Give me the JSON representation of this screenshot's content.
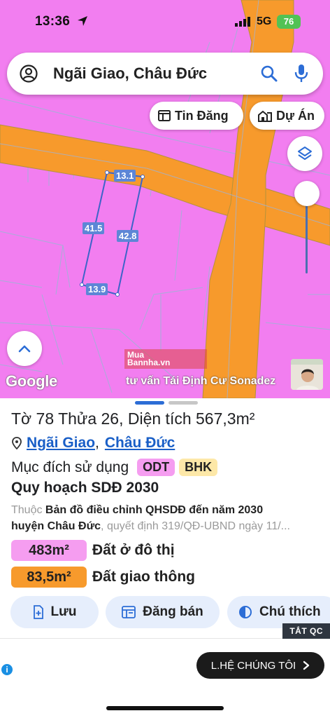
{
  "status": {
    "time": "13:36",
    "network": "5G",
    "battery": "76"
  },
  "search": {
    "query": "Ngãi Giao, Châu Đức"
  },
  "chips": {
    "tin_dang": "Tin Đăng",
    "du_an": "Dự Án"
  },
  "map": {
    "google_label": "Google",
    "watermark_line1": "Mua",
    "watermark_line2": "Bannha.vn",
    "ad_caption": "tư vấn Tái Định Cư Sonadez",
    "edges": {
      "top": "13.1",
      "left": "41.5",
      "right": "42.8",
      "bottom": "13.9"
    },
    "colors": {
      "residential": "#f27ef0",
      "road": "#f79a2c"
    }
  },
  "sheet": {
    "title": "Tờ 78 Thửa 26, Diện tích 567,3m²",
    "location_ward": "Ngãi Giao",
    "location_district": "Châu Đức",
    "purpose_label": "Mục đích sử dụng",
    "purpose_codes": [
      "ODT",
      "BHK"
    ],
    "plan_title": "Quy hoạch SDĐ 2030",
    "plan_desc_prefix": "Thuộc",
    "plan_desc_main": "Bản đồ điều chỉnh QHSDĐ đến năm 2030",
    "plan_desc_line2_main": "huyện Châu Đức",
    "plan_desc_line2_rest": ", quyết định 319/QĐ-UBND ngày 11/...",
    "legend": [
      {
        "area": "483m²",
        "name": "Đất ở đô thị",
        "color": "#f59df0"
      },
      {
        "area": "83,5m²",
        "name": "Đất giao thông",
        "color": "#f79a2c"
      }
    ],
    "actions": {
      "save": "Lưu",
      "post_sale": "Đăng bán",
      "note": "Chú thích"
    }
  },
  "ad": {
    "close_label": "TẮT QC",
    "cta": "L.HỆ CHÚNG TÔI"
  }
}
